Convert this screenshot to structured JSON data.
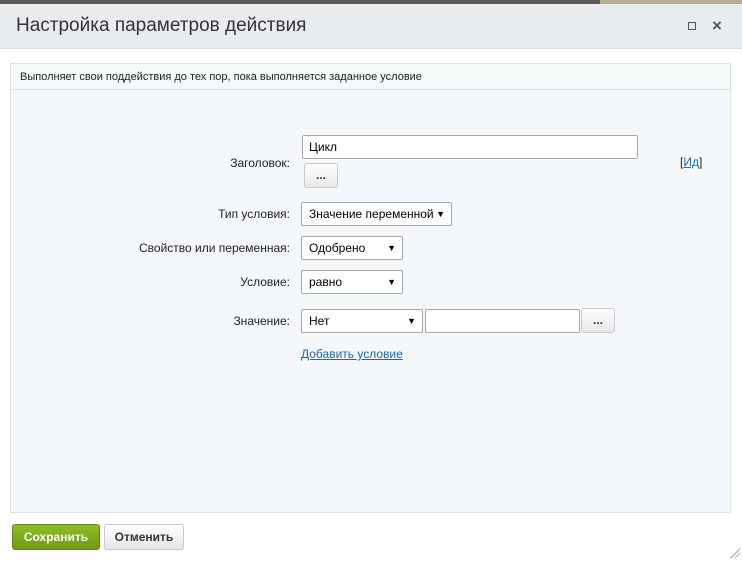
{
  "dialog": {
    "title": "Настройка параметров действия",
    "description": "Выполняет свои поддействия до тех пор, пока выполняется заданное условие"
  },
  "form": {
    "title_label": "Заголовок:",
    "title_value": "Цикл",
    "title_dots_button": "...",
    "id_link_prefix": "[",
    "id_link": "Ид",
    "id_link_suffix": "]",
    "condition_type_label": "Тип условия:",
    "condition_type_value": "Значение переменной",
    "property_label": "Свойство или переменная:",
    "property_value": "Одобрено",
    "condition_label": "Условие:",
    "condition_value": "равно",
    "value_label": "Значение:",
    "value_select": "Нет",
    "value_input": "",
    "value_dots_button": "...",
    "add_condition_link": "Добавить условие"
  },
  "footer": {
    "save_label": "Сохранить",
    "cancel_label": "Отменить"
  },
  "icons": {
    "maximize": "maximize-icon",
    "close": "close-icon",
    "dropdown": "chevron-down-icon"
  },
  "colors": {
    "save_button": "#7aa81a",
    "link": "#2067b0",
    "titlebar": "#e8ecee",
    "content_bg": "#f4f8fa"
  }
}
